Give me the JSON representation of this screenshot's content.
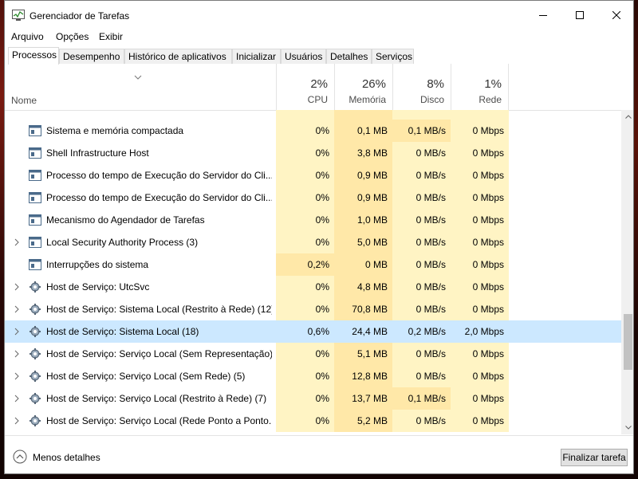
{
  "window": {
    "title": "Gerenciador de Tarefas"
  },
  "menu": [
    "Arquivo",
    "Opções",
    "Exibir"
  ],
  "tabs": [
    "Processos",
    "Desempenho",
    "Histórico de aplicativos",
    "Inicializar",
    "Usuários",
    "Detalhes",
    "Serviços"
  ],
  "columns": {
    "name": "Nome",
    "cpu": {
      "pct": "2%",
      "label": "CPU"
    },
    "mem": {
      "pct": "26%",
      "label": "Memória"
    },
    "disk": {
      "pct": "8%",
      "label": "Disco"
    },
    "net": {
      "pct": "1%",
      "label": "Rede"
    }
  },
  "rows": [
    {
      "name": "Sistema e memória compactada",
      "cpu": "0%",
      "mem": "0,1 MB",
      "disk": "0,1 MB/s",
      "net": "0 Mbps",
      "icon": "system-window-icon"
    },
    {
      "name": "Shell Infrastructure Host",
      "cpu": "0%",
      "mem": "3,8 MB",
      "disk": "0 MB/s",
      "net": "0 Mbps",
      "icon": "system-window-icon"
    },
    {
      "name": "Processo do tempo de Execução do Servidor do Cli...",
      "cpu": "0%",
      "mem": "0,9 MB",
      "disk": "0 MB/s",
      "net": "0 Mbps",
      "icon": "system-window-icon"
    },
    {
      "name": "Processo do tempo de Execução do Servidor do Cli...",
      "cpu": "0%",
      "mem": "0,9 MB",
      "disk": "0 MB/s",
      "net": "0 Mbps",
      "icon": "system-window-icon"
    },
    {
      "name": "Mecanismo do Agendador de Tarefas",
      "cpu": "0%",
      "mem": "1,0 MB",
      "disk": "0 MB/s",
      "net": "0 Mbps",
      "icon": "system-window-icon"
    },
    {
      "name": "Local Security Authority Process (3)",
      "cpu": "0%",
      "mem": "5,0 MB",
      "disk": "0 MB/s",
      "net": "0 Mbps",
      "icon": "system-window-icon"
    },
    {
      "name": "Interrupções do sistema",
      "cpu": "0,2%",
      "mem": "0 MB",
      "disk": "0 MB/s",
      "net": "0 Mbps",
      "icon": "system-window-icon"
    },
    {
      "name": "Host de Serviço: UtcSvc",
      "cpu": "0%",
      "mem": "4,8 MB",
      "disk": "0 MB/s",
      "net": "0 Mbps",
      "icon": "gear-icon"
    },
    {
      "name": "Host de Serviço: Sistema Local (Restrito à Rede) (12)",
      "cpu": "0%",
      "mem": "70,8 MB",
      "disk": "0 MB/s",
      "net": "0 Mbps",
      "icon": "gear-icon"
    },
    {
      "name": "Host de Serviço: Sistema Local (18)",
      "cpu": "0,6%",
      "mem": "24,4 MB",
      "disk": "0,2 MB/s",
      "net": "2,0 Mbps",
      "icon": "gear-icon"
    },
    {
      "name": "Host de Serviço: Serviço Local (Sem Representação)...",
      "cpu": "0%",
      "mem": "5,1 MB",
      "disk": "0 MB/s",
      "net": "0 Mbps",
      "icon": "gear-icon"
    },
    {
      "name": "Host de Serviço: Serviço Local (Sem Rede) (5)",
      "cpu": "0%",
      "mem": "12,8 MB",
      "disk": "0 MB/s",
      "net": "0 Mbps",
      "icon": "gear-icon"
    },
    {
      "name": "Host de Serviço: Serviço Local (Restrito à Rede) (7)",
      "cpu": "0%",
      "mem": "13,7 MB",
      "disk": "0,1 MB/s",
      "net": "0 Mbps",
      "icon": "gear-icon"
    },
    {
      "name": "Host de Serviço: Serviço Local (Rede Ponto a Ponto...",
      "cpu": "0%",
      "mem": "5,2 MB",
      "disk": "0 MB/s",
      "net": "0 Mbps",
      "icon": "gear-icon"
    }
  ],
  "footer": {
    "less_details": "Menos detalhes",
    "end_task": "Finalizar tarefa"
  },
  "colors": {
    "heat_light": "#fff4c4",
    "heat_med": "#ffe8a8",
    "selection": "#cce8ff"
  }
}
